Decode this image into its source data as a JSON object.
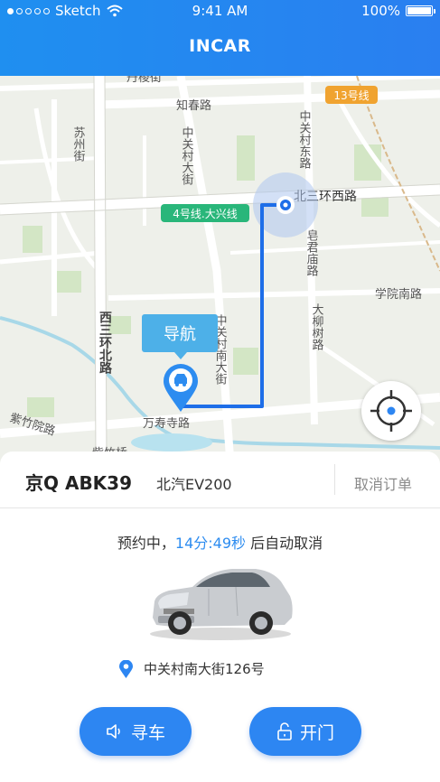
{
  "status_bar": {
    "carrier": "Sketch",
    "time": "9:41 AM",
    "battery": "100%",
    "signal_dots_filled": 1,
    "signal_dots_total": 5,
    "battery_level": 1.0
  },
  "header": {
    "title": "INCAR"
  },
  "map": {
    "labels": {
      "danlou": "丹棱街",
      "zhichun": "知春路",
      "suzhou": "苏州街",
      "zhongguancun_dajie": "中关村大街",
      "zhongguancun_donglu": "中关村东路",
      "beisanhuan_xilu": "北三环西路",
      "zaojun": "皂君庙路",
      "xisanhuan": "西三环北路",
      "zhongguancun_nan": "中关村南大街",
      "xueyuan_nanlu": "学院南路",
      "daliushu": "大柳树路",
      "zizhuyuan": "紫竹院路",
      "wanshousi": "万寿寺路",
      "zizhuqiao": "紫竹桥"
    },
    "badges": {
      "line13": "13号线",
      "line4": "4号线.大兴线"
    },
    "navigate_label": "导航",
    "colors": {
      "route": "#1e6ee8",
      "badge13": "#f0a330",
      "badge4": "#29b67a"
    }
  },
  "card": {
    "plate": "京Q ABK39",
    "model": "北汽EV200",
    "cancel_label": "取消订单",
    "reserve_prefix": "预约中，",
    "countdown": "14分:49秒",
    "reserve_suffix": " 后自动取消",
    "address": "中关村南大街126号"
  },
  "actions": {
    "find_car_label": "寻车",
    "open_door_label": "开门"
  },
  "colors": {
    "accent": "#2d86f2",
    "header": "#1f8ff0"
  }
}
